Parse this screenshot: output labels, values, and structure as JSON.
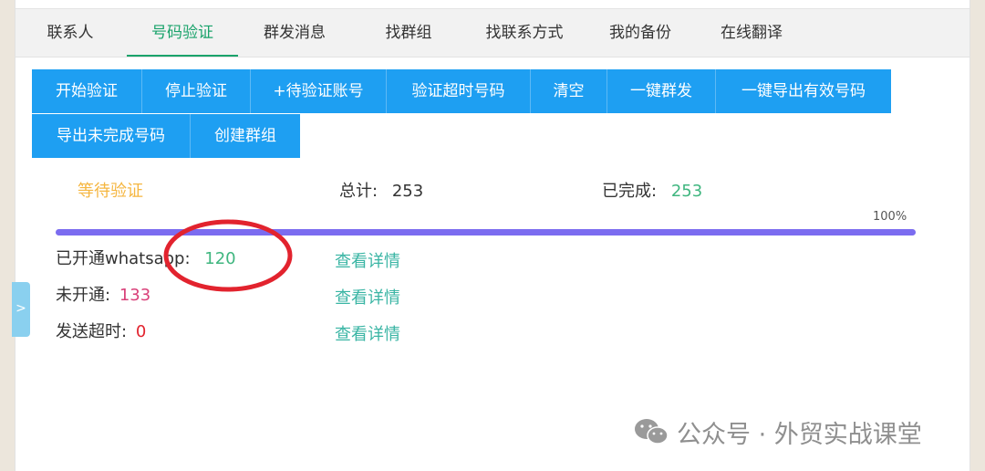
{
  "tabs": {
    "contacts": "联系人",
    "verify": "号码验证",
    "broadcast": "群发消息",
    "find_group": "找群组",
    "find_contact": "找联系方式",
    "backup": "我的备份",
    "translate": "在线翻译"
  },
  "toolbar": {
    "start": "开始验证",
    "stop": "停止验证",
    "add_pending": "+待验证账号",
    "timeout_numbers": "验证超时号码",
    "clear": "清空",
    "one_click_send": "一键群发",
    "export_valid": "一键导出有效号码",
    "export_incomplete": "导出未完成号码",
    "create_group": "创建群组"
  },
  "status": {
    "state": "等待验证",
    "total_label": "总计:",
    "total_value": "253",
    "done_label": "已完成:",
    "done_value": "253",
    "progress_percent": 100,
    "progress_text": "100%"
  },
  "results": {
    "opened_label": "已开通whatsapp:",
    "opened_value": "120",
    "not_opened_label": "未开通:",
    "not_opened_value": "133",
    "timeout_label": "发送超时:",
    "timeout_value": "0",
    "detail_link": "查看详情"
  },
  "side_tab": {
    "label": ">"
  },
  "watermark": {
    "text": "公众号 · 外贸实战课堂"
  },
  "colors": {
    "accent_green": "#1aa36b",
    "button_blue": "#1e9ff2",
    "progress": "#7b6cf0",
    "annotation_red": "#e2232e"
  }
}
